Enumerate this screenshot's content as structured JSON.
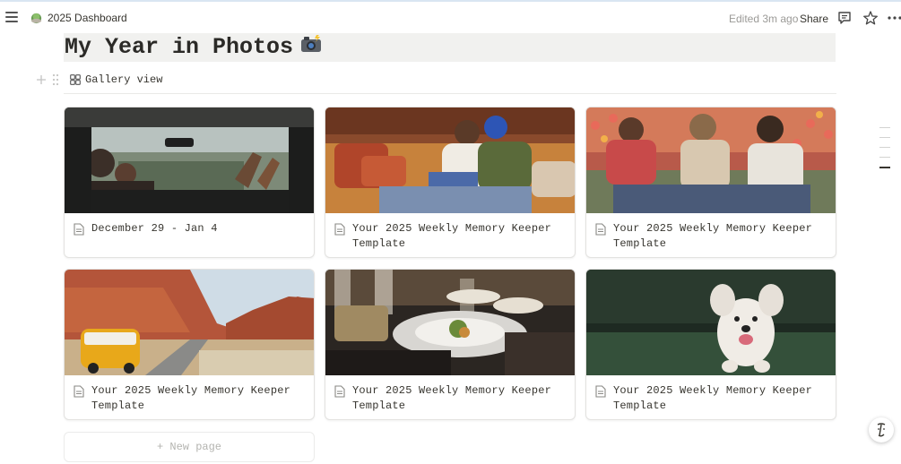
{
  "topbar": {
    "workspace_title": "2025 Dashboard",
    "edited_label": "Edited 3m ago",
    "share_label": "Share"
  },
  "page": {
    "title": "My Year in Photos",
    "title_emoji": "camera-flash-emoji"
  },
  "view": {
    "label": "Gallery view"
  },
  "cards": [
    {
      "title": "December 29 - Jan 4",
      "image": "road-trip-van-interior-photo"
    },
    {
      "title": "Your 2025 Weekly Memory Keeper Template",
      "image": "friends-on-couch-with-laptop-photo"
    },
    {
      "title": "Your 2025 Weekly Memory Keeper Template",
      "image": "friends-laughing-in-tulip-field-photo"
    },
    {
      "title": "Your 2025 Weekly Memory Keeper Template",
      "image": "yellow-van-in-canyon-photo"
    },
    {
      "title": "Your 2025 Weekly Memory Keeper Template",
      "image": "dinner-plate-restaurant-photo"
    },
    {
      "title": "Your 2025 Weekly Memory Keeper Template",
      "image": "white-puppy-running-photo"
    }
  ],
  "new_page": {
    "label": "+ New page"
  },
  "colors": {
    "title_bg": "#f1f1ef",
    "text": "#37352f",
    "muted": "#9b9a97"
  }
}
